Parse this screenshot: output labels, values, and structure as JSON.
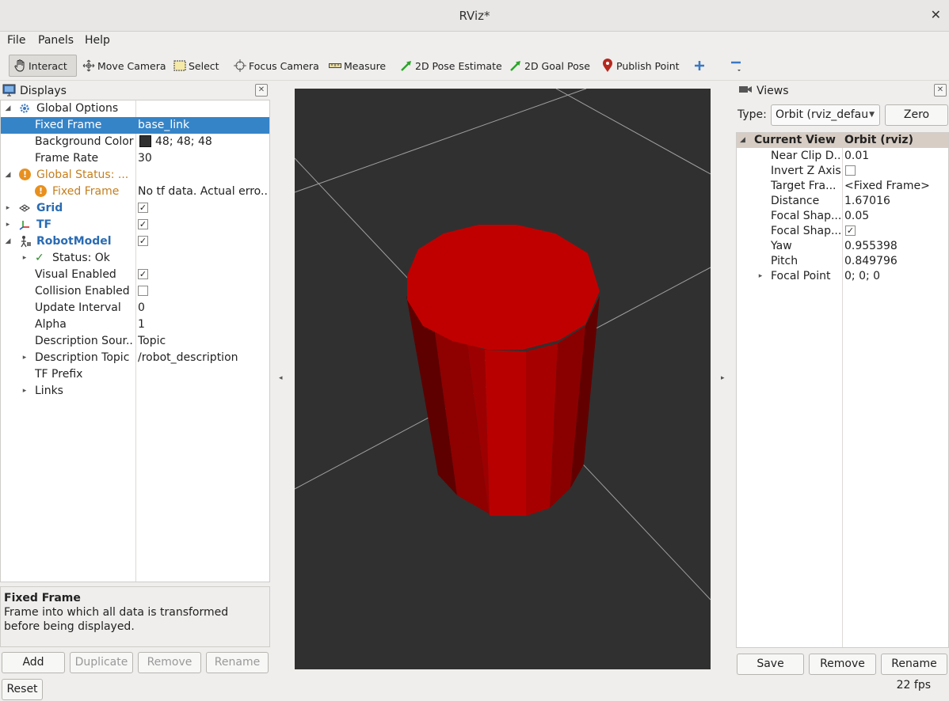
{
  "window": {
    "title": "RViz*"
  },
  "menu": [
    "File",
    "Panels",
    "Help"
  ],
  "toolbar": {
    "tools": [
      {
        "label": "Interact",
        "icon": "hand-icon",
        "active": true
      },
      {
        "label": "Move Camera",
        "icon": "move-camera-icon"
      },
      {
        "label": "Select",
        "icon": "select-icon"
      },
      {
        "label": "Focus Camera",
        "icon": "focus-camera-icon"
      },
      {
        "label": "Measure",
        "icon": "ruler-icon"
      },
      {
        "label": "2D Pose Estimate",
        "icon": "green-arrow-icon"
      },
      {
        "label": "2D Goal Pose",
        "icon": "green-arrow-icon"
      },
      {
        "label": "Publish Point",
        "icon": "pin-icon"
      }
    ]
  },
  "displays": {
    "title": "Displays",
    "rows": [
      {
        "key": "Global Options",
        "value": ""
      },
      {
        "key": "Fixed Frame",
        "value": "base_link"
      },
      {
        "key": "Background Color",
        "value": "48; 48; 48"
      },
      {
        "key": "Frame Rate",
        "value": "30"
      },
      {
        "key": "Global Status: ...",
        "value": ""
      },
      {
        "key": "Fixed Frame",
        "value": "No tf data.  Actual erro..."
      },
      {
        "key": "Grid",
        "value": ""
      },
      {
        "key": "TF",
        "value": ""
      },
      {
        "key": "RobotModel",
        "value": ""
      },
      {
        "key": "Status: Ok",
        "value": ""
      },
      {
        "key": "Visual Enabled",
        "value": ""
      },
      {
        "key": "Collision Enabled",
        "value": ""
      },
      {
        "key": "Update Interval",
        "value": "0"
      },
      {
        "key": "Alpha",
        "value": "1"
      },
      {
        "key": "Description Sour...",
        "value": "Topic"
      },
      {
        "key": "Description Topic",
        "value": "/robot_description"
      },
      {
        "key": "TF Prefix",
        "value": ""
      },
      {
        "key": "Links",
        "value": ""
      }
    ],
    "help_title": "Fixed Frame",
    "help_text": "Frame into which all data is transformed before being displayed.",
    "buttons": {
      "add": "Add",
      "duplicate": "Duplicate",
      "remove": "Remove",
      "rename": "Rename"
    },
    "reset": "Reset"
  },
  "views": {
    "title": "Views",
    "type_label": "Type:",
    "type_value": "Orbit (rviz_defau",
    "zero": "Zero",
    "header_key": "Current View",
    "header_value": "Orbit (rviz)",
    "rows": [
      {
        "key": "Near Clip D...",
        "value": "0.01"
      },
      {
        "key": "Invert Z Axis",
        "value": ""
      },
      {
        "key": "Target Fra...",
        "value": "<Fixed Frame>"
      },
      {
        "key": "Distance",
        "value": "1.67016"
      },
      {
        "key": "Focal Shap...",
        "value": "0.05"
      },
      {
        "key": "Focal Shap...",
        "value": ""
      },
      {
        "key": "Yaw",
        "value": "0.955398"
      },
      {
        "key": "Pitch",
        "value": "0.849796"
      },
      {
        "key": "Focal Point",
        "value": "0; 0; 0"
      }
    ],
    "buttons": {
      "save": "Save",
      "remove": "Remove",
      "rename": "Rename"
    }
  },
  "status": {
    "fps": "22 fps"
  },
  "colors": {
    "background": "#303030",
    "robot": "#c00000",
    "selection": "#3584c8",
    "warning": "#c47e1d"
  }
}
